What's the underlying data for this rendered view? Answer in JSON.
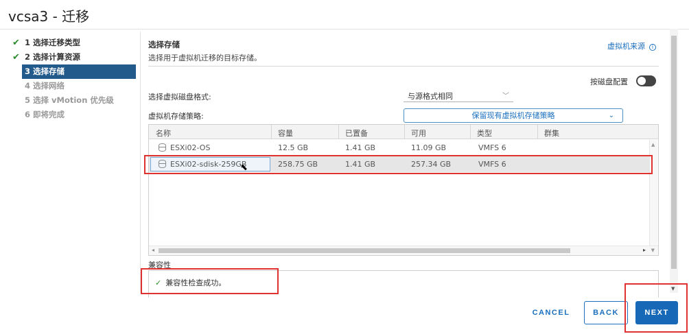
{
  "window": {
    "title": "vcsa3 - 迁移"
  },
  "steps": [
    {
      "num": "1",
      "label": "选择迁移类型",
      "state": "done"
    },
    {
      "num": "2",
      "label": "选择计算资源",
      "state": "done"
    },
    {
      "num": "3",
      "label": "选择存储",
      "state": "active"
    },
    {
      "num": "4",
      "label": "选择网络",
      "state": "pending"
    },
    {
      "num": "5",
      "label": "选择 vMotion 优先级",
      "state": "pending"
    },
    {
      "num": "6",
      "label": "即将完成",
      "state": "pending"
    }
  ],
  "header": {
    "title": "选择存储",
    "subtitle": "选择用于虚拟机迁移的目标存储。",
    "source_link": "虚拟机来源"
  },
  "toggle": {
    "label": "按磁盘配置",
    "on": false
  },
  "form": {
    "format_label": "选择虚拟磁盘格式:",
    "format_value": "与源格式相同",
    "policy_label": "虚拟机存储策略:",
    "policy_value": "保留现有虚拟机存储策略"
  },
  "table": {
    "columns": [
      "名称",
      "容量",
      "已置备",
      "可用",
      "类型",
      "群集"
    ],
    "rows": [
      {
        "name": "ESXi02-OS",
        "capacity": "12.5 GB",
        "provisioned": "1.41 GB",
        "free": "11.09 GB",
        "type": "VMFS 6",
        "cluster": "",
        "selected": false
      },
      {
        "name": "ESXi02-sdisk-259GB",
        "capacity": "258.75 GB",
        "provisioned": "1.41 GB",
        "free": "257.34 GB",
        "type": "VMFS 6",
        "cluster": "",
        "selected": true
      }
    ]
  },
  "compat": {
    "title": "兼容性",
    "message": "兼容性检查成功。"
  },
  "footer": {
    "cancel": "CANCEL",
    "back": "BACK",
    "next": "NEXT"
  },
  "colors": {
    "accent": "#1769b7",
    "active_step": "#235a8c",
    "highlight": "#e03030",
    "success": "#2e8b2e"
  }
}
